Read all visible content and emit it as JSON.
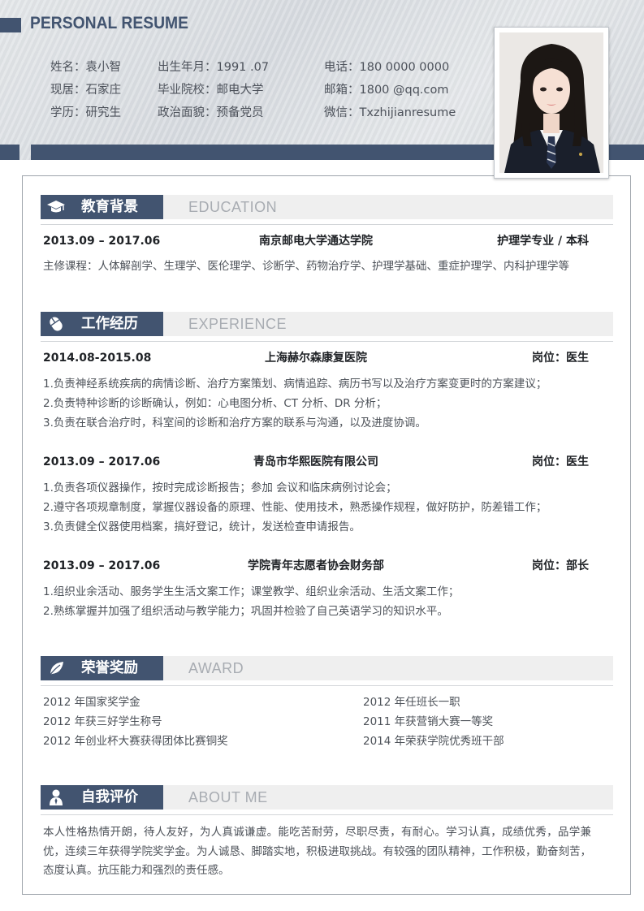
{
  "header": {
    "title": "PERSONAL RESUME",
    "info": [
      {
        "label": "姓名：",
        "value": "袁小智"
      },
      {
        "label": "出生年月：",
        "value": "1991 .07"
      },
      {
        "label": "电话：",
        "value": "180 0000 0000"
      },
      {
        "label": "现居：",
        "value": "石家庄"
      },
      {
        "label": "毕业院校：",
        "value": "邮电大学"
      },
      {
        "label": "邮箱：",
        "value": "1800 @qq.com"
      },
      {
        "label": "学历：",
        "value": "研究生"
      },
      {
        "label": "政治面貌：",
        "value": "预备党员"
      },
      {
        "label": "微信：",
        "value": "Txzhijianresume"
      }
    ]
  },
  "colors": {
    "accent": "#425470",
    "section_light": "#efefef",
    "text": "#4d5259"
  },
  "sections": {
    "education": {
      "title_cn": "教育背景",
      "title_en": "EDUCATION",
      "icon": "graduation-cap-icon",
      "entries": [
        {
          "date": "2013.09 – 2017.06",
          "org": "南京邮电大学通达学院",
          "role": "护理学专业 / 本科",
          "lines": [
            "主修课程：人体解剖学、生理学、医伦理学、诊断学、药物治疗学、护理学基础、重症护理学、内科护理学等"
          ]
        }
      ]
    },
    "experience": {
      "title_cn": "工作经历",
      "title_en": "EXPERIENCE",
      "icon": "mouse-icon",
      "entries": [
        {
          "date": "2014.08-2015.08",
          "org": "上海赫尔森康复医院",
          "role": "岗位：医生",
          "lines": [
            "1.负责神经系统疾病的病情诊断、治疗方案策划、病情追踪、病历书写以及治疗方案变更时的方案建议；",
            "2.负责特种诊断的诊断确认，例如：心电图分析、CT 分析、DR 分析；",
            "3.负责在联合治疗时，科室间的诊断和治疗方案的联系与沟通，以及进度协调。"
          ]
        },
        {
          "date": "2013.09 – 2017.06",
          "org": "青岛市华熙医院有限公司",
          "role": "岗位：医生",
          "lines": [
            "1.负责各项仪器操作，按时完成诊断报告；参加 会议和临床病例讨论会；",
            "2.遵守各项规章制度，掌握仪器设备的原理、性能、使用技术，熟悉操作规程，做好防护，防差错工作；",
            "3.负责健全仪器使用档案，搞好登记，统计，发送检查申请报告。"
          ]
        },
        {
          "date": "2013.09 – 2017.06",
          "org": "学院青年志愿者协会财务部",
          "role": "岗位：部长",
          "lines": [
            "1.组织业余活动、服务学生生活文案工作；课堂教学、组织业余活动、生活文案工作；",
            "2.熟练掌握并加强了组织活动与教学能力；巩固并检验了自己英语学习的知识水平。"
          ]
        }
      ]
    },
    "award": {
      "title_cn": "荣誉奖励",
      "title_en": "AWARD",
      "icon": "leaf-icon",
      "items": [
        "2012 年国家奖学金",
        "2012 年任班长一职",
        "2012 年获三好学生称号",
        "2011 年获营销大赛一等奖",
        "2012 年创业杯大赛获得团体比赛铜奖",
        "2014 年荣获学院优秀班干部"
      ]
    },
    "about": {
      "title_cn": "自我评价",
      "title_en": "ABOUT ME",
      "icon": "person-icon",
      "text": "本人性格热情开朗，待人友好，为人真诚谦虚。能吃苦耐劳，尽职尽责，有耐心。学习认真，成绩优秀，品学兼优，连续三年获得学院奖学金。为人诚恳、脚踏实地，积极进取挑战。有较强的团队精神，工作积极，勤奋刻苦，态度认真。抗压能力和强烈的责任感。"
    }
  }
}
